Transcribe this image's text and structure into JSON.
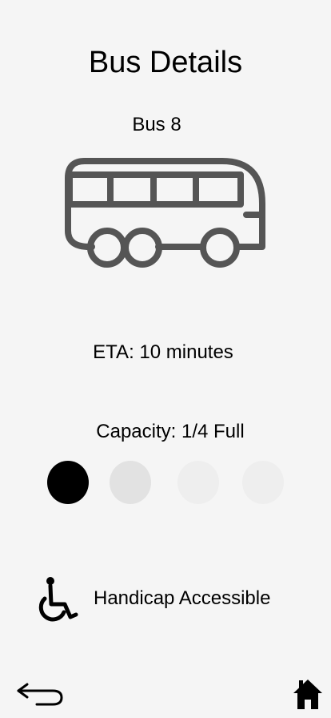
{
  "page": {
    "title": "Bus Details"
  },
  "bus": {
    "name": "Bus 8",
    "icon": "bus-icon"
  },
  "eta": {
    "text": "ETA: 10 minutes"
  },
  "capacity": {
    "text": "Capacity: 1/4 Full",
    "filled": 1,
    "total": 4,
    "dot_colors": [
      "#000000",
      "#e2e2e2",
      "#eeeeee",
      "#eeeeee"
    ]
  },
  "accessibility": {
    "icon": "wheelchair-icon",
    "label": "Handicap Accessible"
  },
  "nav": {
    "back_icon": "back-arrow-icon",
    "home_icon": "home-icon"
  },
  "colors": {
    "background": "#f5f5f5",
    "icon_gray": "#555555",
    "text": "#000000"
  }
}
